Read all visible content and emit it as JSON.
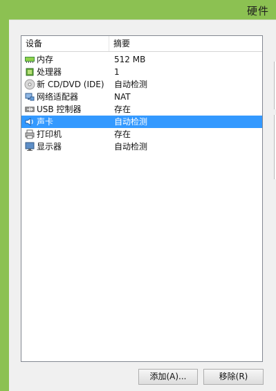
{
  "window": {
    "title": "硬件"
  },
  "table": {
    "headers": {
      "device": "设备",
      "summary": "摘要"
    },
    "rows": [
      {
        "device": "内存",
        "summary": "512 MB",
        "icon": "memory-icon",
        "selected": false
      },
      {
        "device": "处理器",
        "summary": "1",
        "icon": "processor-icon",
        "selected": false
      },
      {
        "device": "新 CD/DVD (IDE)",
        "summary": "自动检测",
        "icon": "cd-dvd-icon",
        "selected": false
      },
      {
        "device": "网络适配器",
        "summary": "NAT",
        "icon": "network-adapter-icon",
        "selected": false
      },
      {
        "device": "USB 控制器",
        "summary": "存在",
        "icon": "usb-icon",
        "selected": false
      },
      {
        "device": "声卡",
        "summary": "自动检测",
        "icon": "sound-card-icon",
        "selected": true
      },
      {
        "device": "打印机",
        "summary": "存在",
        "icon": "printer-icon",
        "selected": false
      },
      {
        "device": "显示器",
        "summary": "自动检测",
        "icon": "display-icon",
        "selected": false
      }
    ]
  },
  "buttons": {
    "add": "添加(A)...",
    "remove": "移除(R)"
  },
  "colors": {
    "selection": "#3399ff",
    "title_bar": "#8cc152"
  }
}
